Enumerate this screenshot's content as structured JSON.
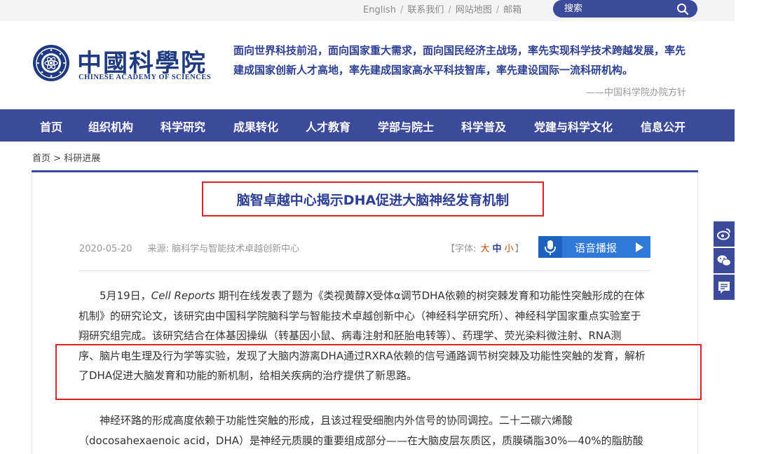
{
  "topbar": {
    "links": [
      "English",
      "联系我们",
      "网站地图",
      "邮箱"
    ],
    "search_placeholder": "搜索"
  },
  "header": {
    "logo_cn": "中國科學院",
    "logo_en": "CHINESE ACADEMY OF SCIENCES",
    "motto_line1": "面向世界科技前沿，面向国家重大需求，面向国民经济主战场，率先实现科学技术跨越发展，率先",
    "motto_line2": "建成国家创新人才高地，率先建成国家高水平科技智库，率先建设国际一流科研机构。",
    "motto_sign": "——中国科学院办院方针"
  },
  "nav": {
    "items": [
      "首页",
      "组织机构",
      "科学研究",
      "成果转化",
      "人才教育",
      "学部与院士",
      "科学普及",
      "党建与科学文化",
      "信息公开"
    ]
  },
  "breadcrumb": {
    "home": "首页",
    "sep": " > ",
    "current": "科研进展"
  },
  "article": {
    "title": "脑智卓越中心揭示DHA促进大脑神经发育机制",
    "date": "2020-05-20",
    "source_label": "来源:",
    "source": "脑科学与智能技术卓越创新中心",
    "font_label": "【字体:",
    "font_large": "大",
    "font_mid": "中",
    "font_small": "小",
    "font_end": "】",
    "voice_label": "语音播报",
    "p1_lead": "5月19日，",
    "p1_journal": "Cell Reports",
    "p1_line1_rest": " 期刊在线发表了题为《类视黄醇X受体α调节DHA依赖的树突棘发育和功能性突触形成的在体",
    "p1_line2": "机制》的研究论文，该研究由中国科学院脑科学与智能技术卓越创新中心（神经科学研究所）、神经科学国家重点实验室于",
    "p1_line3": "翔研究组完成。该研究结合在体基因操纵（转基因小鼠、病毒注射和胚胎电转等）、药理学、荧光染料微注射、RNA测",
    "p1_line4": "序、脑片电生理及行为学等实验，发现了大脑内游离DHA通过RXRA依赖的信号通路调节树突棘及功能性突触的发育，解析",
    "p1_line5": "了DHA促进大脑发育和功能的新机制，给相关疾病的治疗提供了新思路。",
    "p2_line1": "神经环路的形成高度依赖于功能性突触的形成，且该过程受细胞内外信号的协同调控。二十二碳六烯酸",
    "p2_line2": "（docosahexaenoic acid，DHA）是神经元质膜的重要组成部分——在大脑皮层灰质区，质膜磷脂30%—40%的脂肪酸"
  },
  "share": {
    "icons": [
      "weibo-icon",
      "wechat-icon",
      "comment-icon"
    ]
  },
  "colors": {
    "brand_blue": "#3b4a9b",
    "highlight_red": "#e02020",
    "voice_blue": "#2f7ad8"
  }
}
